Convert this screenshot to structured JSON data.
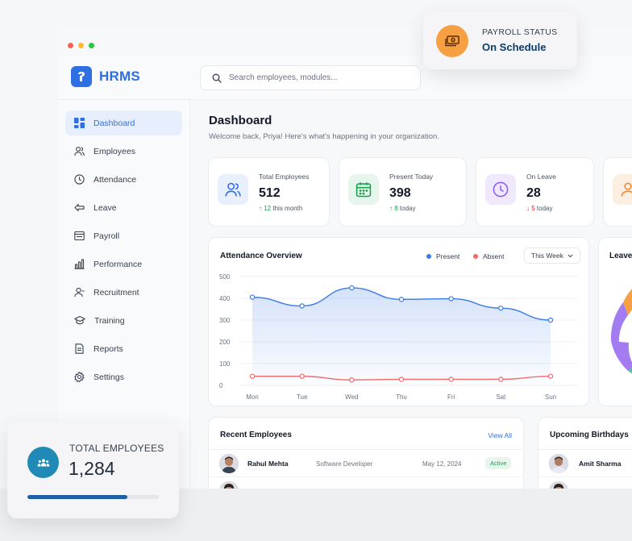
{
  "app": {
    "logo_text": "HRMS",
    "accent": "#2f6fe4",
    "traffic_lights": [
      "#ff5f57",
      "#febc2e",
      "#28c840"
    ]
  },
  "search": {
    "placeholder": "Search employees, modules..."
  },
  "sidebar": {
    "items": [
      {
        "label": "Dashboard",
        "icon": "dashboard-icon",
        "active": true
      },
      {
        "label": "Employees",
        "icon": "users-icon"
      },
      {
        "label": "Attendance",
        "icon": "clock-icon"
      },
      {
        "label": "Leave",
        "icon": "leave-arrow-icon"
      },
      {
        "label": "Payroll",
        "icon": "payroll-icon"
      },
      {
        "label": "Performance",
        "icon": "bar-chart-icon"
      },
      {
        "label": "Recruitment",
        "icon": "user-search-icon"
      },
      {
        "label": "Training",
        "icon": "graduation-cap-icon"
      },
      {
        "label": "Reports",
        "icon": "document-icon"
      },
      {
        "label": "Settings",
        "icon": "gear-icon"
      }
    ]
  },
  "main": {
    "title": "Dashboard",
    "subtitle": "Welcome back, Priya! Here's what's happening in your organization."
  },
  "stats": [
    {
      "label": "Total Employees",
      "value": "512",
      "delta_arrow": "↑",
      "delta_value": "12",
      "delta_text": "this month",
      "color": "#2f6fe4",
      "icon": "users-icon"
    },
    {
      "label": "Present Today",
      "value": "398",
      "delta_arrow": "↑",
      "delta_value": "8",
      "delta_text": "today",
      "color": "#16a34a",
      "icon": "calendar-icon"
    },
    {
      "label": "On Leave",
      "value": "28",
      "delta_arrow": "↓",
      "delta_value": "5",
      "delta_text": "today",
      "color": "#8b5cf6",
      "icon": "clock-icon"
    }
  ],
  "attendance": {
    "title": "Attendance Overview",
    "legend_present": "Present",
    "legend_absent": "Absent",
    "range_label": "This Week",
    "colors": {
      "present": "#3b7be6",
      "absent": "#ef6a6a"
    }
  },
  "chart_data": {
    "type": "line",
    "title": "Attendance Overview",
    "categories": [
      "Mon",
      "Tue",
      "Wed",
      "Thu",
      "Fri",
      "Sat",
      "Sun"
    ],
    "series": [
      {
        "name": "Present",
        "values": [
          405,
          365,
          448,
          395,
          398,
          355,
          300
        ]
      },
      {
        "name": "Absent",
        "values": [
          42,
          42,
          25,
          28,
          28,
          28,
          42
        ]
      }
    ],
    "yticks": [
      0,
      100,
      200,
      300,
      400,
      500
    ],
    "ylim": [
      0,
      500
    ],
    "grid": true,
    "legend_position": "top-right"
  },
  "leave_card": {
    "title_partial": "Leave"
  },
  "recent": {
    "title": "Recent Employees",
    "view_all": "View All",
    "rows": [
      {
        "name": "Rahul Mehta",
        "role": "Software Developer",
        "date": "May 12, 2024",
        "status": "Active"
      }
    ]
  },
  "birthdays": {
    "title": "Upcoming Birthdays",
    "rows": [
      {
        "name": "Amit Sharma"
      }
    ]
  },
  "payroll_float": {
    "label": "PAYROLL STATUS",
    "value": "On Schedule"
  },
  "total_float": {
    "label": "TOTAL EMPLOYEES",
    "value": "1,284",
    "progress": 0.76
  }
}
